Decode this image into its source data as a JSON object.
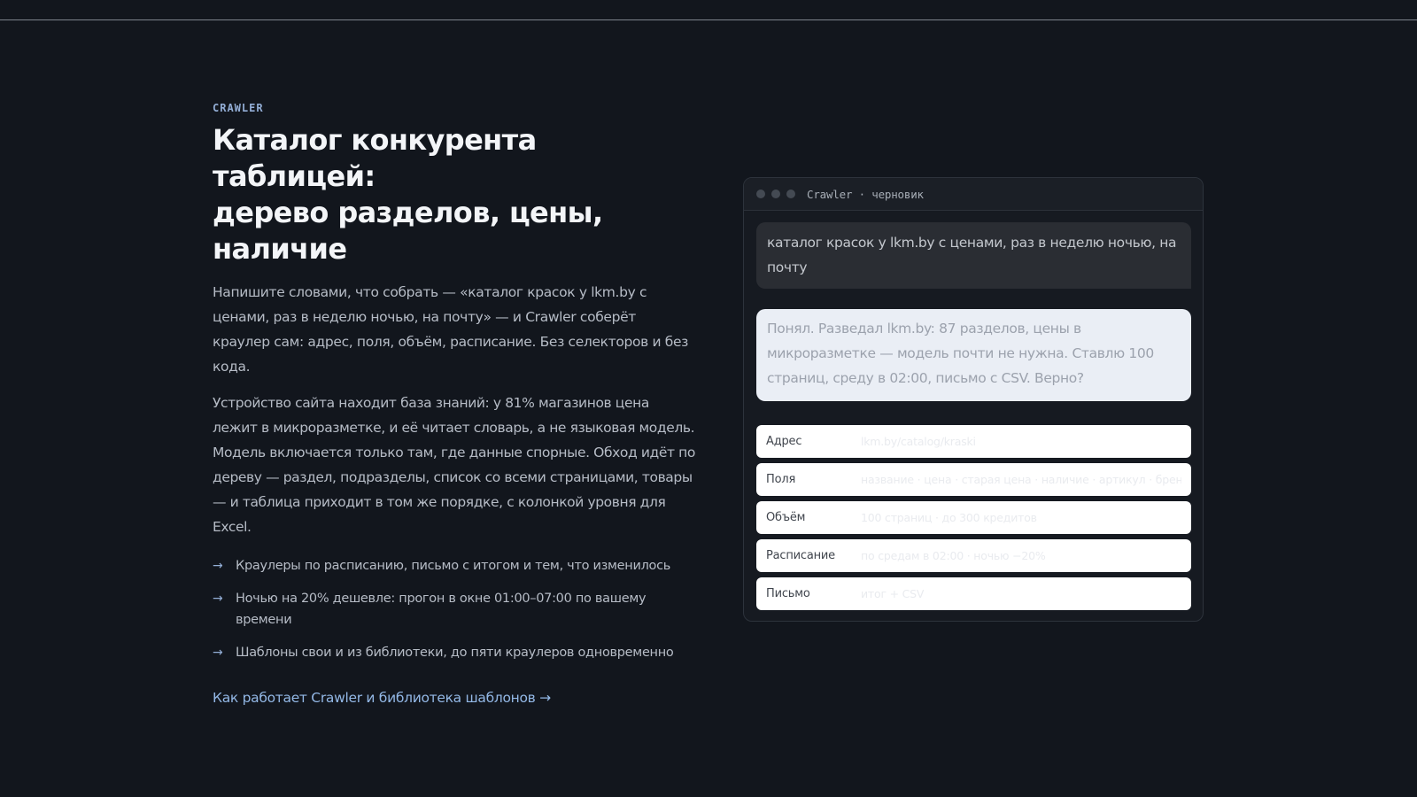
{
  "hero": {
    "eyebrow": "CRAWLER",
    "title_line1": "Каталог конкурента таблицей:",
    "title_line2": "дерево разделов, цены,",
    "title_line3": "наличие",
    "paragraph1": "Напишите словами, что собрать — «каталог красок у lkm.by с ценами, раз в неделю ночью, на почту» — и Crawler соберёт краулер сам: адрес, поля, объём, расписание. Без селекторов и без кода.",
    "paragraph2": "Устройство сайта находит база знаний: у 81% магазинов цена лежит в микроразметке, и её читает словарь, а не языковая модель. Модель включается только там, где данные спорные. Обход идёт по дереву — раздел, подразделы, список со всеми страницами, товары — и таблица приходит в том же порядке, с колонкой уровня для Excel.",
    "bullets": [
      "Краулеры по расписанию, письмо с итогом и тем, что изменилось",
      "Ночью на 20% дешевле: прогон в окне 01:00–07:00 по вашему времени",
      "Шаблоны свои и из библиотеки, до пяти краулеров одновременно"
    ],
    "bullet_arrow": "→",
    "link_text": "Как работает Crawler и библиотека шаблонов →"
  },
  "window": {
    "title": "Crawler · черновик",
    "user_message": "каталог красок у lkm.by с ценами, раз в неделю ночью, на почту",
    "bot_message": "Понял. Разведал lkm.by: 87 разделов, цены в микроразметке — модель почти не нужна. Ставлю 100 страниц, среду в 02:00, письмо с CSV. Верно?",
    "fields": [
      {
        "label": "Адрес",
        "value": "lkm.by/catalog/kraski"
      },
      {
        "label": "Поля",
        "value": "название · цена · старая цена · наличие · артикул · бренд"
      },
      {
        "label": "Объём",
        "value": "100 страниц · до 300 кредитов"
      },
      {
        "label": "Расписание",
        "value": "по средам в 02:00 · ночью −20%"
      },
      {
        "label": "Письмо",
        "value": "итог + CSV"
      }
    ]
  },
  "colors": {
    "background": "#12161d",
    "accent": "#93b8e6",
    "eyebrow": "#93aed6"
  }
}
